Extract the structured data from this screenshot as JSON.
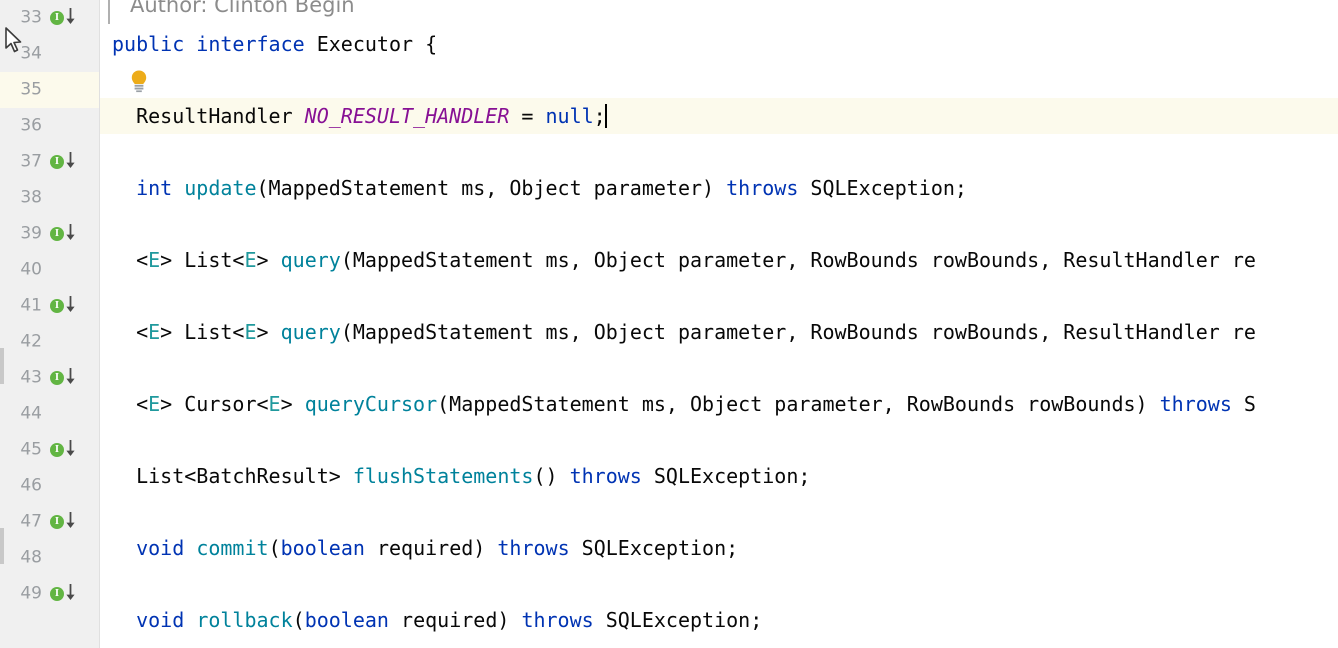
{
  "editor": {
    "language": "java",
    "theme": "IntelliJ Light",
    "colors": {
      "background": "#ffffff",
      "gutter_background": "#f0f0f0",
      "current_line_highlight": "#fcfaec",
      "keyword": "#0033b3",
      "method": "#00829b",
      "constant": "#871094",
      "type_parameter": "#20999d",
      "text": "#080808",
      "line_number": "#999da1",
      "javadoc_text": "#8c8c8c",
      "implementation_badge": "#62b543",
      "intention_bulb": "#edac1a"
    },
    "javadoc": {
      "text": "Author: Clinton Begin"
    },
    "icons": {
      "intention_bulb": "lightbulb-icon",
      "implemented_marker": "implemented-interface-icon",
      "implementation_arrow": "arrow-down-icon",
      "mouse_cursor": "mouse-pointer-icon"
    },
    "caret": {
      "line": 35,
      "column": 34
    },
    "lines": [
      {
        "number": 33,
        "has_impl_marker": true,
        "current": false,
        "tokens": [
          {
            "t": "public",
            "c": "kw"
          },
          {
            "t": " ",
            "c": "plain"
          },
          {
            "t": "interface",
            "c": "kw"
          },
          {
            "t": " Executor {",
            "c": "plain"
          }
        ]
      },
      {
        "number": 34,
        "has_impl_marker": false,
        "current": false,
        "bulb": true,
        "tokens": []
      },
      {
        "number": 35,
        "has_impl_marker": false,
        "current": true,
        "caret": true,
        "tokens": [
          {
            "t": "  ResultHandler ",
            "c": "plain"
          },
          {
            "t": "NO_RESULT_HANDLER",
            "c": "cons"
          },
          {
            "t": " = ",
            "c": "plain"
          },
          {
            "t": "null",
            "c": "kw"
          },
          {
            "t": ";",
            "c": "plain"
          }
        ]
      },
      {
        "number": 36,
        "has_impl_marker": false,
        "current": false,
        "tokens": []
      },
      {
        "number": 37,
        "has_impl_marker": true,
        "current": false,
        "tokens": [
          {
            "t": "  ",
            "c": "plain"
          },
          {
            "t": "int",
            "c": "kw"
          },
          {
            "t": " ",
            "c": "plain"
          },
          {
            "t": "update",
            "c": "meth"
          },
          {
            "t": "(MappedStatement ms, Object parameter) ",
            "c": "plain"
          },
          {
            "t": "throws",
            "c": "kw"
          },
          {
            "t": " SQLException;",
            "c": "plain"
          }
        ]
      },
      {
        "number": 38,
        "has_impl_marker": false,
        "current": false,
        "tokens": []
      },
      {
        "number": 39,
        "has_impl_marker": true,
        "current": false,
        "tokens": [
          {
            "t": "  <",
            "c": "plain"
          },
          {
            "t": "E",
            "c": "tparam"
          },
          {
            "t": "> List<",
            "c": "plain"
          },
          {
            "t": "E",
            "c": "tparam"
          },
          {
            "t": "> ",
            "c": "plain"
          },
          {
            "t": "query",
            "c": "meth"
          },
          {
            "t": "(MappedStatement ms, Object parameter, RowBounds rowBounds, ResultHandler re",
            "c": "plain"
          }
        ]
      },
      {
        "number": 40,
        "has_impl_marker": false,
        "current": false,
        "tokens": []
      },
      {
        "number": 41,
        "has_impl_marker": true,
        "current": false,
        "tokens": [
          {
            "t": "  <",
            "c": "plain"
          },
          {
            "t": "E",
            "c": "tparam"
          },
          {
            "t": "> List<",
            "c": "plain"
          },
          {
            "t": "E",
            "c": "tparam"
          },
          {
            "t": "> ",
            "c": "plain"
          },
          {
            "t": "query",
            "c": "meth"
          },
          {
            "t": "(MappedStatement ms, Object parameter, RowBounds rowBounds, ResultHandler re",
            "c": "plain"
          }
        ]
      },
      {
        "number": 42,
        "has_impl_marker": false,
        "current": false,
        "tokens": []
      },
      {
        "number": 43,
        "has_impl_marker": true,
        "current": false,
        "tokens": [
          {
            "t": "  <",
            "c": "plain"
          },
          {
            "t": "E",
            "c": "tparam"
          },
          {
            "t": "> Cursor<",
            "c": "plain"
          },
          {
            "t": "E",
            "c": "tparam"
          },
          {
            "t": "> ",
            "c": "plain"
          },
          {
            "t": "queryCursor",
            "c": "meth"
          },
          {
            "t": "(MappedStatement ms, Object parameter, RowBounds rowBounds) ",
            "c": "plain"
          },
          {
            "t": "throws",
            "c": "kw"
          },
          {
            "t": " S",
            "c": "plain"
          }
        ]
      },
      {
        "number": 44,
        "has_impl_marker": false,
        "current": false,
        "tokens": []
      },
      {
        "number": 45,
        "has_impl_marker": true,
        "current": false,
        "tokens": [
          {
            "t": "  List<BatchResult> ",
            "c": "plain"
          },
          {
            "t": "flushStatements",
            "c": "meth"
          },
          {
            "t": "() ",
            "c": "plain"
          },
          {
            "t": "throws",
            "c": "kw"
          },
          {
            "t": " SQLException;",
            "c": "plain"
          }
        ]
      },
      {
        "number": 46,
        "has_impl_marker": false,
        "current": false,
        "tokens": []
      },
      {
        "number": 47,
        "has_impl_marker": true,
        "current": false,
        "tokens": [
          {
            "t": "  ",
            "c": "plain"
          },
          {
            "t": "void",
            "c": "kw"
          },
          {
            "t": " ",
            "c": "plain"
          },
          {
            "t": "commit",
            "c": "meth"
          },
          {
            "t": "(",
            "c": "plain"
          },
          {
            "t": "boolean",
            "c": "kw"
          },
          {
            "t": " required) ",
            "c": "plain"
          },
          {
            "t": "throws",
            "c": "kw"
          },
          {
            "t": " SQLException;",
            "c": "plain"
          }
        ]
      },
      {
        "number": 48,
        "has_impl_marker": false,
        "current": false,
        "tokens": []
      },
      {
        "number": 49,
        "has_impl_marker": true,
        "current": false,
        "tokens": [
          {
            "t": "  ",
            "c": "plain"
          },
          {
            "t": "void",
            "c": "kw"
          },
          {
            "t": " ",
            "c": "plain"
          },
          {
            "t": "rollback",
            "c": "meth"
          },
          {
            "t": "(",
            "c": "plain"
          },
          {
            "t": "boolean",
            "c": "kw"
          },
          {
            "t": " required) ",
            "c": "plain"
          },
          {
            "t": "throws",
            "c": "kw"
          },
          {
            "t": " SQLException;",
            "c": "plain"
          }
        ]
      }
    ]
  }
}
